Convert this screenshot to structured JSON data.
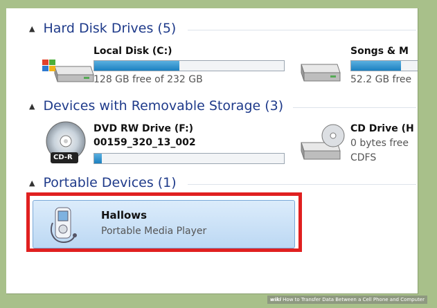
{
  "groups": {
    "hard_disk": {
      "label": "Hard Disk Drives (5)",
      "drives": [
        {
          "name": "Local Disk (C:)",
          "info": "128 GB free of 232 GB",
          "used_fraction": 0.45
        },
        {
          "name": "Songs & M",
          "info": "52.2 GB free",
          "used_fraction": 0.6
        }
      ]
    },
    "removable": {
      "label": "Devices with Removable Storage (3)",
      "drives": [
        {
          "name": "DVD RW Drive (F:)",
          "info": "00159_320_13_002",
          "used_fraction": 0.04,
          "badge": "CD-R"
        },
        {
          "name": "CD Drive (H",
          "info": "0 bytes free",
          "fs": "CDFS"
        }
      ]
    },
    "portable": {
      "label": "Portable Devices (1)",
      "device": {
        "name": "Hallows",
        "type": "Portable Media Player"
      }
    }
  },
  "watermark": {
    "brand": "wiki",
    "text": "How to Transfer Data Between a Cell Phone and Computer"
  },
  "colors": {
    "header": "#1e3a8a",
    "highlight": "#e02020",
    "bar": "#1c80c0"
  }
}
